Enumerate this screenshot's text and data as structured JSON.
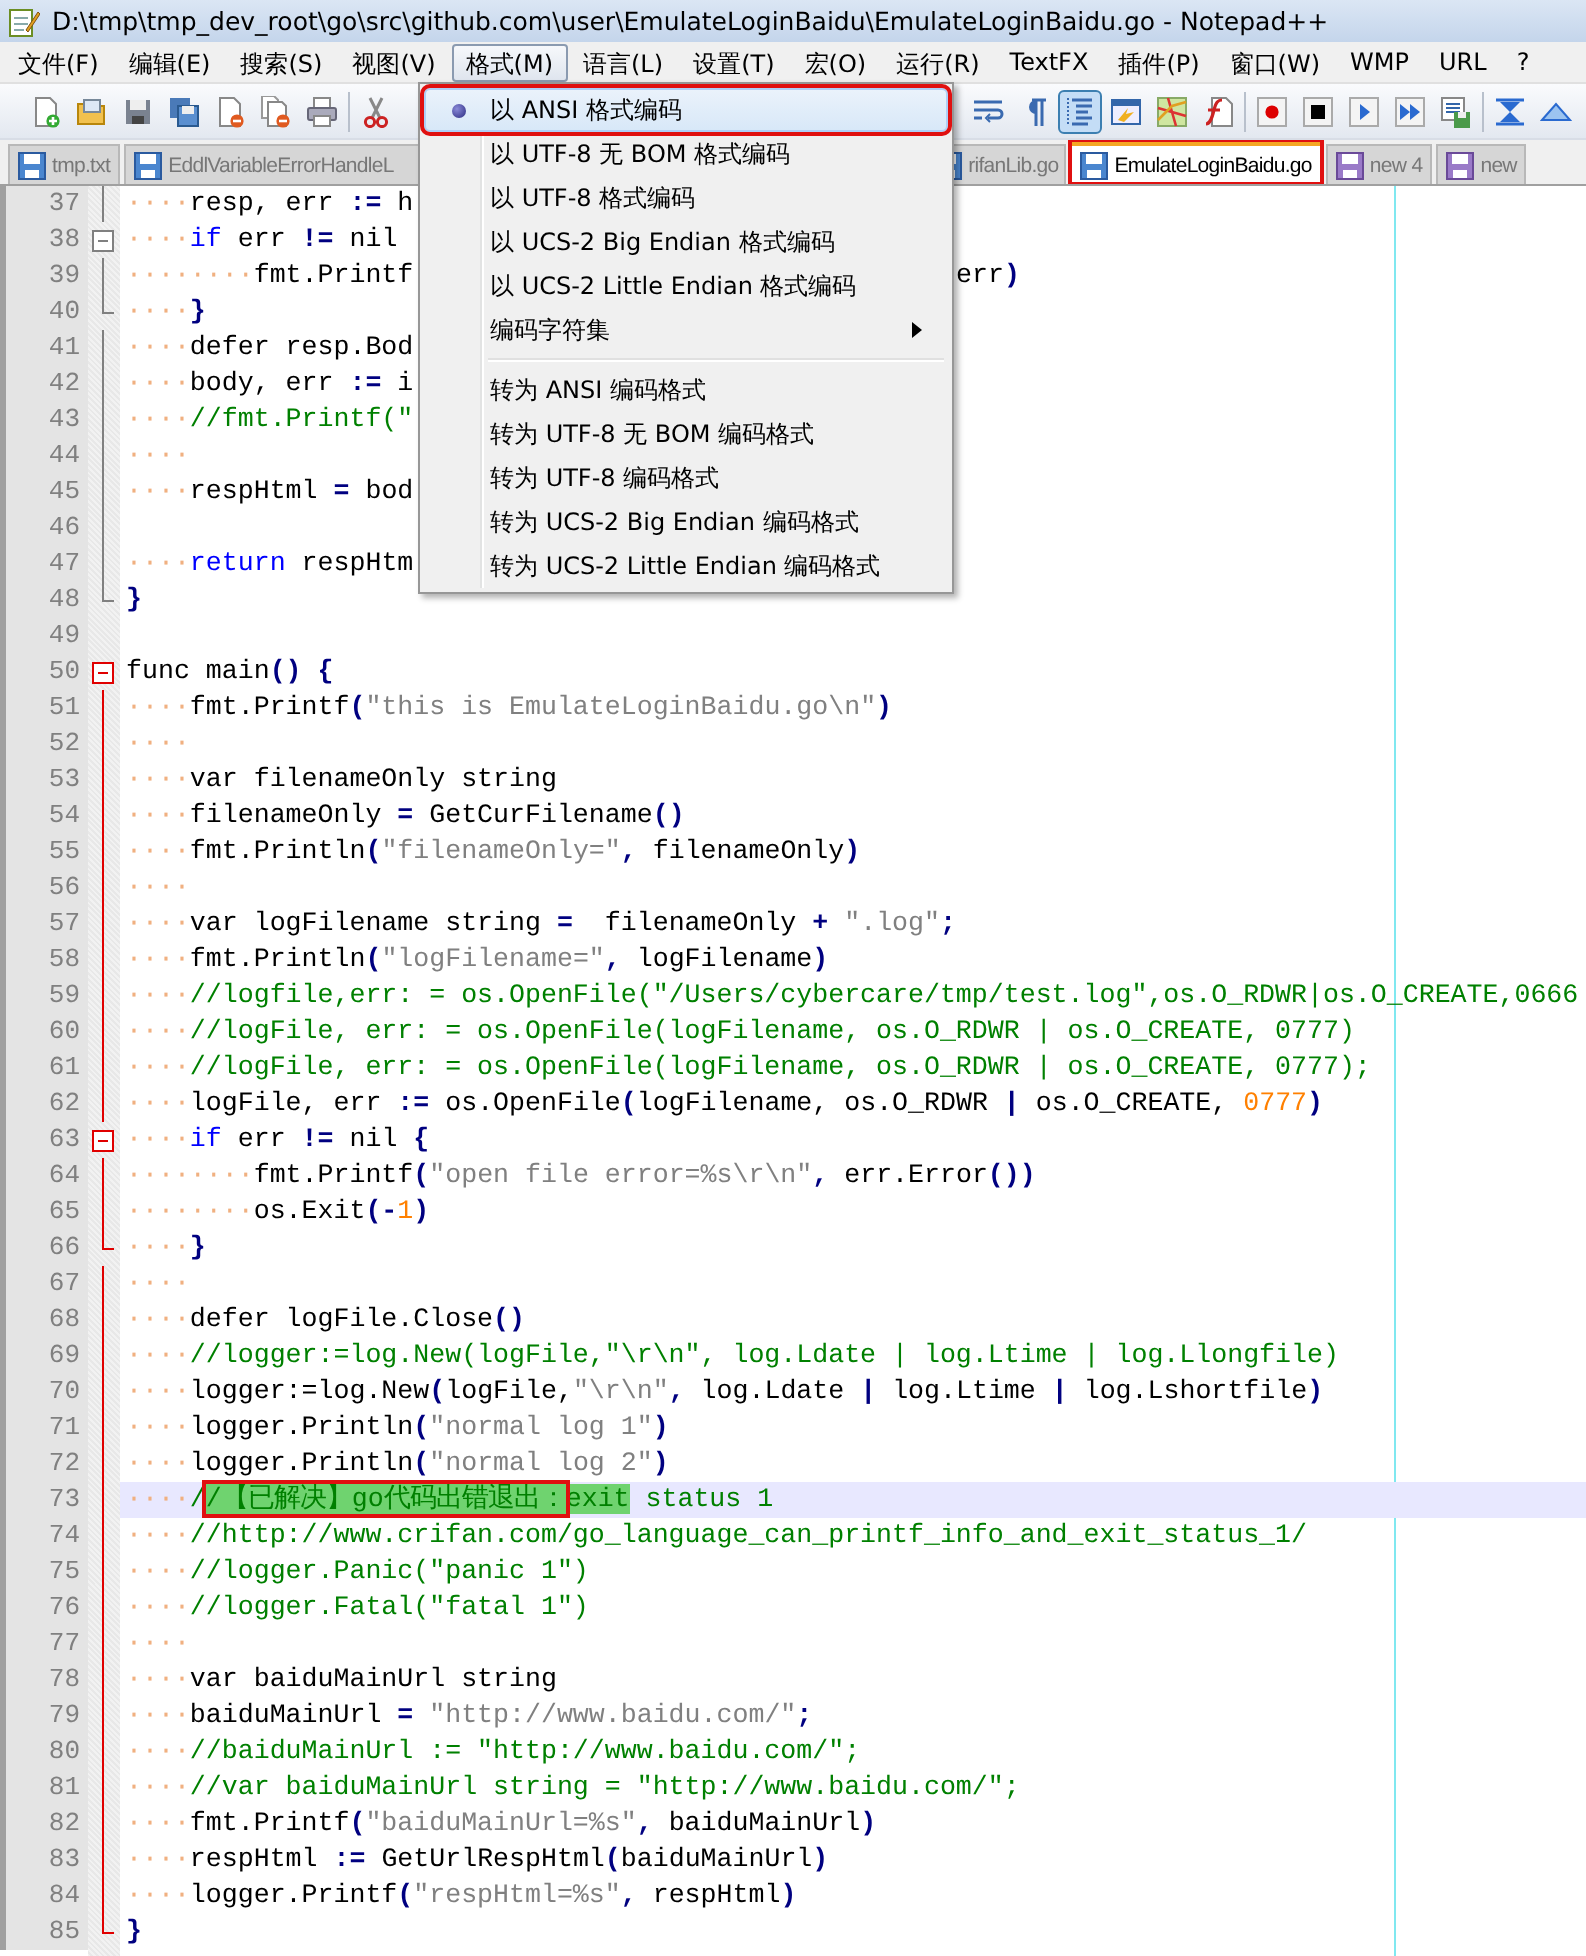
{
  "window": {
    "title": "D:\\tmp\\tmp_dev_root\\go\\src\\github.com\\user\\EmulateLoginBaidu\\EmulateLoginBaidu.go - Notepad++"
  },
  "menu_bar": [
    {
      "label": "文件(F)",
      "selected": false
    },
    {
      "label": "编辑(E)",
      "selected": false
    },
    {
      "label": "搜索(S)",
      "selected": false
    },
    {
      "label": "视图(V)",
      "selected": false
    },
    {
      "label": "格式(M)",
      "selected": true
    },
    {
      "label": "语言(L)",
      "selected": false
    },
    {
      "label": "设置(T)",
      "selected": false
    },
    {
      "label": "宏(O)",
      "selected": false
    },
    {
      "label": "运行(R)",
      "selected": false
    },
    {
      "label": "TextFX",
      "selected": false
    },
    {
      "label": "插件(P)",
      "selected": false
    },
    {
      "label": "窗口(W)",
      "selected": false
    },
    {
      "label": "WMP",
      "selected": false
    },
    {
      "label": "URL",
      "selected": false
    },
    {
      "label": "?",
      "selected": false
    }
  ],
  "toolbar_left": [
    {
      "kind": "page-plus",
      "pressed": false
    },
    {
      "kind": "folder",
      "pressed": false
    },
    {
      "kind": "floppy",
      "pressed": false
    },
    {
      "kind": "floppies",
      "pressed": false
    },
    {
      "kind": "page-minus",
      "pressed": false
    },
    {
      "kind": "pages-minus",
      "pressed": false
    },
    {
      "kind": "printer",
      "pressed": false
    },
    {
      "kind": "separator"
    },
    {
      "kind": "scissors",
      "pressed": false
    }
  ],
  "toolbar_right": [
    {
      "kind": "wrap-lines",
      "pressed": false
    },
    {
      "kind": "pilcrow",
      "pressed": false
    },
    {
      "kind": "indent-guide",
      "pressed": true
    },
    {
      "kind": "window-panel",
      "pressed": false
    },
    {
      "kind": "map",
      "pressed": false
    },
    {
      "kind": "function-doc",
      "pressed": false
    },
    {
      "kind": "separator"
    },
    {
      "kind": "record-dot",
      "pressed": false
    },
    {
      "kind": "stop-square",
      "pressed": false
    },
    {
      "kind": "play-triangle",
      "pressed": false
    },
    {
      "kind": "fast-forward",
      "pressed": false
    },
    {
      "kind": "floppy-list",
      "pressed": false
    },
    {
      "kind": "separator"
    },
    {
      "kind": "collapse-arrows",
      "pressed": false
    },
    {
      "kind": "up-triangle",
      "pressed": false
    }
  ],
  "tabs": [
    {
      "label": "tmp.txt",
      "selected": false,
      "unsaved": false,
      "annotated": false
    },
    {
      "label": "EddlVariableErrorHandleL",
      "selected": false,
      "unsaved": false,
      "annotated": false
    },
    {
      "label": "rifanLib.go",
      "selected": false,
      "annotated": false
    },
    {
      "label": "EmulateLoginBaidu.go",
      "selected": true,
      "unsaved": false,
      "annotated": true
    },
    {
      "label": "new  4",
      "selected": false,
      "unsaved": true,
      "annotated": false
    },
    {
      "label": "new",
      "selected": false,
      "unsaved": true,
      "annotated": false
    }
  ],
  "format_menu": [
    {
      "kind": "radio-item",
      "label": "以 ANSI 格式编码",
      "checked": true,
      "selected": true,
      "annotated": true
    },
    {
      "kind": "radio-item",
      "label": "以 UTF-8 无 BOM 格式编码",
      "checked": false,
      "selected": false,
      "annotated": false
    },
    {
      "kind": "radio-item",
      "label": "以 UTF-8 格式编码",
      "checked": false,
      "selected": false,
      "annotated": false
    },
    {
      "kind": "radio-item",
      "label": "以 UCS-2 Big Endian 格式编码",
      "checked": false,
      "selected": false,
      "annotated": false
    },
    {
      "kind": "radio-item",
      "label": "以 UCS-2 Little Endian 格式编码",
      "checked": false,
      "selected": false,
      "annotated": false
    },
    {
      "kind": "submenu",
      "label": "编码字符集",
      "checked": false,
      "selected": false,
      "annotated": false
    },
    {
      "kind": "separator"
    },
    {
      "kind": "radio-item",
      "label": "转为 ANSI 编码格式",
      "checked": false,
      "selected": false,
      "annotated": false
    },
    {
      "kind": "radio-item",
      "label": "转为 UTF-8 无 BOM 编码格式",
      "checked": false,
      "selected": false,
      "annotated": false
    },
    {
      "kind": "radio-item",
      "label": "转为 UTF-8 编码格式",
      "checked": false,
      "selected": false,
      "annotated": false
    },
    {
      "kind": "radio-item",
      "label": "转为 UCS-2 Big Endian 编码格式",
      "checked": false,
      "selected": false,
      "annotated": false
    },
    {
      "kind": "radio-item",
      "label": "转为 UCS-2 Little Endian 编码格式",
      "checked": false,
      "selected": false,
      "annotated": false
    }
  ],
  "lines": [
    {
      "number": "37",
      "fold": {
        "kind": "line",
        "active": false
      },
      "current": false,
      "tokens": [
        {
          "text": "····",
          "kind": "ws"
        },
        {
          "text": "resp, err ",
          "kind": "id"
        },
        {
          "text": ":=",
          "kind": "op"
        },
        {
          "text": " h",
          "kind": "id"
        }
      ]
    },
    {
      "number": "38",
      "fold": {
        "kind": "open",
        "active": false
      },
      "current": false,
      "tokens": [
        {
          "text": "····",
          "kind": "ws"
        },
        {
          "text": "if",
          "kind": "kw"
        },
        {
          "text": " err ",
          "kind": "id"
        },
        {
          "text": "!=",
          "kind": "op"
        },
        {
          "text": " nil",
          "kind": "id"
        }
      ]
    },
    {
      "number": "39",
      "fold": {
        "kind": "line",
        "active": false
      },
      "current": false,
      "tokens": [
        {
          "text": "········",
          "kind": "ws"
        },
        {
          "text": "fmt.Printf",
          "kind": "id"
        }
      ],
      "tail": [
        {
          "text": "err",
          "kind": "id"
        },
        {
          "text": ")",
          "kind": "op"
        }
      ]
    },
    {
      "number": "40",
      "fold": {
        "kind": "end",
        "active": false
      },
      "current": false,
      "tokens": [
        {
          "text": "····",
          "kind": "ws"
        },
        {
          "text": "}",
          "kind": "op"
        }
      ]
    },
    {
      "number": "41",
      "fold": {
        "kind": "line",
        "active": false
      },
      "current": false,
      "tokens": [
        {
          "text": "····",
          "kind": "ws"
        },
        {
          "text": "defer resp.Bod",
          "kind": "id"
        }
      ]
    },
    {
      "number": "42",
      "fold": {
        "kind": "line",
        "active": false
      },
      "current": false,
      "tokens": [
        {
          "text": "····",
          "kind": "ws"
        },
        {
          "text": "body, err ",
          "kind": "id"
        },
        {
          "text": ":=",
          "kind": "op"
        },
        {
          "text": " i",
          "kind": "id"
        }
      ]
    },
    {
      "number": "43",
      "fold": {
        "kind": "line",
        "active": false
      },
      "current": false,
      "tokens": [
        {
          "text": "····",
          "kind": "ws"
        },
        {
          "text": "//fmt.Printf(\"",
          "kind": "cmt"
        }
      ]
    },
    {
      "number": "44",
      "fold": {
        "kind": "line",
        "active": false
      },
      "current": false,
      "tokens": [
        {
          "text": "····",
          "kind": "ws"
        }
      ]
    },
    {
      "number": "45",
      "fold": {
        "kind": "line",
        "active": false
      },
      "current": false,
      "tokens": [
        {
          "text": "····",
          "kind": "ws"
        },
        {
          "text": "respHtml ",
          "kind": "id"
        },
        {
          "text": "=",
          "kind": "op"
        },
        {
          "text": " bod",
          "kind": "id"
        }
      ]
    },
    {
      "number": "46",
      "fold": {
        "kind": "line",
        "active": false
      },
      "current": false
    },
    {
      "number": "47",
      "fold": {
        "kind": "line",
        "active": false
      },
      "current": false,
      "tokens": [
        {
          "text": "····",
          "kind": "ws"
        },
        {
          "text": "return",
          "kind": "kw"
        },
        {
          "text": " respHtm",
          "kind": "id"
        }
      ]
    },
    {
      "number": "48",
      "fold": {
        "kind": "end",
        "active": false
      },
      "current": false,
      "tokens": [
        {
          "text": "}",
          "kind": "op"
        }
      ]
    },
    {
      "number": "49",
      "current": false
    },
    {
      "number": "50",
      "fold": {
        "kind": "open",
        "active": true
      },
      "current": false,
      "tokens": [
        {
          "text": "func main",
          "kind": "id"
        },
        {
          "text": "() {",
          "kind": "op"
        }
      ]
    },
    {
      "number": "51",
      "fold": {
        "kind": "line",
        "active": true
      },
      "current": false,
      "tokens": [
        {
          "text": "····",
          "kind": "ws"
        },
        {
          "text": "fmt.Printf",
          "kind": "id"
        },
        {
          "text": "(",
          "kind": "op"
        },
        {
          "text": "\"this is EmulateLoginBaidu.go\\n\"",
          "kind": "str"
        },
        {
          "text": ")",
          "kind": "op"
        }
      ]
    },
    {
      "number": "52",
      "fold": {
        "kind": "line",
        "active": true
      },
      "current": false,
      "tokens": [
        {
          "text": "····",
          "kind": "ws"
        }
      ]
    },
    {
      "number": "53",
      "fold": {
        "kind": "line",
        "active": true
      },
      "current": false,
      "tokens": [
        {
          "text": "····",
          "kind": "ws"
        },
        {
          "text": "var filenameOnly string",
          "kind": "id"
        }
      ]
    },
    {
      "number": "54",
      "fold": {
        "kind": "line",
        "active": true
      },
      "current": false,
      "tokens": [
        {
          "text": "····",
          "kind": "ws"
        },
        {
          "text": "filenameOnly ",
          "kind": "id"
        },
        {
          "text": "=",
          "kind": "op"
        },
        {
          "text": " GetCurFilename",
          "kind": "id"
        },
        {
          "text": "()",
          "kind": "op"
        }
      ]
    },
    {
      "number": "55",
      "fold": {
        "kind": "line",
        "active": true
      },
      "current": false,
      "tokens": [
        {
          "text": "····",
          "kind": "ws"
        },
        {
          "text": "fmt.Println",
          "kind": "id"
        },
        {
          "text": "(",
          "kind": "op"
        },
        {
          "text": "\"filenameOnly=\"",
          "kind": "str"
        },
        {
          "text": ",",
          "kind": "op"
        },
        {
          "text": " filenameOnly",
          "kind": "id"
        },
        {
          "text": ")",
          "kind": "op"
        }
      ]
    },
    {
      "number": "56",
      "fold": {
        "kind": "line",
        "active": true
      },
      "current": false,
      "tokens": [
        {
          "text": "····",
          "kind": "ws"
        }
      ]
    },
    {
      "number": "57",
      "fold": {
        "kind": "line",
        "active": true
      },
      "current": false,
      "tokens": [
        {
          "text": "····",
          "kind": "ws"
        },
        {
          "text": "var logFilename string ",
          "kind": "id"
        },
        {
          "text": "=",
          "kind": "op"
        },
        {
          "text": "  filenameOnly ",
          "kind": "id"
        },
        {
          "text": "+",
          "kind": "op"
        },
        {
          "text": " \".log\"",
          "kind": "str"
        },
        {
          "text": ";",
          "kind": "op"
        }
      ]
    },
    {
      "number": "58",
      "fold": {
        "kind": "line",
        "active": true
      },
      "current": false,
      "tokens": [
        {
          "text": "····",
          "kind": "ws"
        },
        {
          "text": "fmt.Println",
          "kind": "id"
        },
        {
          "text": "(",
          "kind": "op"
        },
        {
          "text": "\"logFilename=\"",
          "kind": "str"
        },
        {
          "text": ",",
          "kind": "op"
        },
        {
          "text": " logFilename",
          "kind": "id"
        },
        {
          "text": ")",
          "kind": "op"
        }
      ]
    },
    {
      "number": "59",
      "fold": {
        "kind": "line",
        "active": true
      },
      "current": false,
      "tokens": [
        {
          "text": "····",
          "kind": "ws"
        },
        {
          "text": "//logfile,err: = os.OpenFile(\"/Users/cybercare/tmp/test.log\",os.O_RDWR|os.O_CREATE,0666",
          "kind": "cmt"
        }
      ]
    },
    {
      "number": "60",
      "fold": {
        "kind": "line",
        "active": true
      },
      "current": false,
      "tokens": [
        {
          "text": "····",
          "kind": "ws"
        },
        {
          "text": "//logFile, err: = os.OpenFile(logFilename, os.O_RDWR | os.O_CREATE, 0777)",
          "kind": "cmt"
        }
      ]
    },
    {
      "number": "61",
      "fold": {
        "kind": "line",
        "active": true
      },
      "current": false,
      "tokens": [
        {
          "text": "····",
          "kind": "ws"
        },
        {
          "text": "//logFile, err: = os.OpenFile(logFilename, os.O_RDWR | os.O_CREATE, 0777);",
          "kind": "cmt"
        }
      ]
    },
    {
      "number": "62",
      "fold": {
        "kind": "line",
        "active": true
      },
      "current": false,
      "tokens": [
        {
          "text": "····",
          "kind": "ws"
        },
        {
          "text": "logFile, err ",
          "kind": "id"
        },
        {
          "text": ":=",
          "kind": "op"
        },
        {
          "text": " os.OpenFile",
          "kind": "id"
        },
        {
          "text": "(",
          "kind": "op"
        },
        {
          "text": "logFilename, os.O_RDWR ",
          "kind": "id"
        },
        {
          "text": "|",
          "kind": "op"
        },
        {
          "text": " os.O_CREATE, ",
          "kind": "id"
        },
        {
          "text": "0777",
          "kind": "num"
        },
        {
          "text": ")",
          "kind": "op"
        }
      ]
    },
    {
      "number": "63",
      "fold": {
        "kind": "open",
        "active": true
      },
      "current": false,
      "tokens": [
        {
          "text": "····",
          "kind": "ws"
        },
        {
          "text": "if",
          "kind": "kw"
        },
        {
          "text": " err ",
          "kind": "id"
        },
        {
          "text": "!=",
          "kind": "op"
        },
        {
          "text": " nil ",
          "kind": "id"
        },
        {
          "text": "{",
          "kind": "op"
        }
      ]
    },
    {
      "number": "64",
      "fold": {
        "kind": "line",
        "active": true
      },
      "current": false,
      "tokens": [
        {
          "text": "········",
          "kind": "ws"
        },
        {
          "text": "fmt.Printf",
          "kind": "id"
        },
        {
          "text": "(",
          "kind": "op"
        },
        {
          "text": "\"open file error=%s\\r\\n\"",
          "kind": "str"
        },
        {
          "text": ",",
          "kind": "op"
        },
        {
          "text": " err.Error",
          "kind": "id"
        },
        {
          "text": "())",
          "kind": "op"
        }
      ]
    },
    {
      "number": "65",
      "fold": {
        "kind": "line",
        "active": true
      },
      "current": false,
      "tokens": [
        {
          "text": "········",
          "kind": "ws"
        },
        {
          "text": "os.Exit",
          "kind": "id"
        },
        {
          "text": "(-",
          "kind": "op"
        },
        {
          "text": "1",
          "kind": "num"
        },
        {
          "text": ")",
          "kind": "op"
        }
      ]
    },
    {
      "number": "66",
      "fold": {
        "kind": "end",
        "active": true
      },
      "current": false,
      "tokens": [
        {
          "text": "····",
          "kind": "ws"
        },
        {
          "text": "}",
          "kind": "op"
        }
      ]
    },
    {
      "number": "67",
      "fold": {
        "kind": "line",
        "active": true
      },
      "current": false,
      "tokens": [
        {
          "text": "····",
          "kind": "ws"
        }
      ]
    },
    {
      "number": "68",
      "fold": {
        "kind": "line",
        "active": true
      },
      "current": false,
      "tokens": [
        {
          "text": "····",
          "kind": "ws"
        },
        {
          "text": "defer logFile.Close",
          "kind": "id"
        },
        {
          "text": "()",
          "kind": "op"
        }
      ]
    },
    {
      "number": "69",
      "fold": {
        "kind": "line",
        "active": true
      },
      "current": false,
      "tokens": [
        {
          "text": "····",
          "kind": "ws"
        },
        {
          "text": "//logger:=log.New(logFile,\"\\r\\n\", log.Ldate | log.Ltime | log.Llongfile)",
          "kind": "cmt"
        }
      ]
    },
    {
      "number": "70",
      "fold": {
        "kind": "line",
        "active": true
      },
      "current": false,
      "tokens": [
        {
          "text": "····",
          "kind": "ws"
        },
        {
          "text": "logger:=log.New",
          "kind": "id"
        },
        {
          "text": "(",
          "kind": "op"
        },
        {
          "text": "logFile,",
          "kind": "id"
        },
        {
          "text": "\"\\r\\n\"",
          "kind": "str"
        },
        {
          "text": ",",
          "kind": "op"
        },
        {
          "text": " log.Ldate ",
          "kind": "id"
        },
        {
          "text": "|",
          "kind": "op"
        },
        {
          "text": " log.Ltime ",
          "kind": "id"
        },
        {
          "text": "|",
          "kind": "op"
        },
        {
          "text": " log.Lshortfile",
          "kind": "id"
        },
        {
          "text": ")",
          "kind": "op"
        }
      ]
    },
    {
      "number": "71",
      "fold": {
        "kind": "line",
        "active": true
      },
      "current": false,
      "tokens": [
        {
          "text": "····",
          "kind": "ws"
        },
        {
          "text": "logger.Println",
          "kind": "id"
        },
        {
          "text": "(",
          "kind": "op"
        },
        {
          "text": "\"normal log 1\"",
          "kind": "str"
        },
        {
          "text": ")",
          "kind": "op"
        }
      ]
    },
    {
      "number": "72",
      "fold": {
        "kind": "line",
        "active": true
      },
      "current": false,
      "tokens": [
        {
          "text": "····",
          "kind": "ws"
        },
        {
          "text": "logger.Println",
          "kind": "id"
        },
        {
          "text": "(",
          "kind": "op"
        },
        {
          "text": "\"normal log 2\"",
          "kind": "str"
        },
        {
          "text": ")",
          "kind": "op"
        }
      ]
    },
    {
      "number": "73",
      "fold": {
        "kind": "line",
        "active": true
      },
      "current": true,
      "tokens": [
        {
          "text": "····",
          "kind": "ws"
        },
        {
          "text": "/",
          "kind": "cmt"
        },
        {
          "text": "/【已解决】go代码出错退出：",
          "kind": "mark-boxed"
        },
        {
          "text": "exit",
          "kind": "mark"
        },
        {
          "text": " status 1",
          "kind": "cmt"
        }
      ]
    },
    {
      "number": "74",
      "fold": {
        "kind": "line",
        "active": true
      },
      "current": false,
      "tokens": [
        {
          "text": "····",
          "kind": "ws"
        },
        {
          "text": "//http://www.crifan.com/go_language_can_printf_info_and_exit_status_1/",
          "kind": "cmt"
        }
      ]
    },
    {
      "number": "75",
      "fold": {
        "kind": "line",
        "active": true
      },
      "current": false,
      "tokens": [
        {
          "text": "····",
          "kind": "ws"
        },
        {
          "text": "//logger.Panic(\"panic 1\")",
          "kind": "cmt"
        }
      ]
    },
    {
      "number": "76",
      "fold": {
        "kind": "line",
        "active": true
      },
      "current": false,
      "tokens": [
        {
          "text": "····",
          "kind": "ws"
        },
        {
          "text": "//logger.Fatal(\"fatal 1\")",
          "kind": "cmt"
        }
      ]
    },
    {
      "number": "77",
      "fold": {
        "kind": "line",
        "active": true
      },
      "current": false,
      "tokens": [
        {
          "text": "····",
          "kind": "ws"
        }
      ]
    },
    {
      "number": "78",
      "fold": {
        "kind": "line",
        "active": true
      },
      "current": false,
      "tokens": [
        {
          "text": "····",
          "kind": "ws"
        },
        {
          "text": "var baiduMainUrl string",
          "kind": "id"
        }
      ]
    },
    {
      "number": "79",
      "fold": {
        "kind": "line",
        "active": true
      },
      "current": false,
      "tokens": [
        {
          "text": "····",
          "kind": "ws"
        },
        {
          "text": "baiduMainUrl ",
          "kind": "id"
        },
        {
          "text": "=",
          "kind": "op"
        },
        {
          "text": " \"http://www.baidu.com/\"",
          "kind": "str"
        },
        {
          "text": ";",
          "kind": "op"
        }
      ]
    },
    {
      "number": "80",
      "fold": {
        "kind": "line",
        "active": true
      },
      "current": false,
      "tokens": [
        {
          "text": "····",
          "kind": "ws"
        },
        {
          "text": "//baiduMainUrl := \"http://www.baidu.com/\";",
          "kind": "cmt"
        }
      ]
    },
    {
      "number": "81",
      "fold": {
        "kind": "line",
        "active": true
      },
      "current": false,
      "tokens": [
        {
          "text": "····",
          "kind": "ws"
        },
        {
          "text": "//var baiduMainUrl string = \"http://www.baidu.com/\";",
          "kind": "cmt"
        }
      ]
    },
    {
      "number": "82",
      "fold": {
        "kind": "line",
        "active": true
      },
      "current": false,
      "tokens": [
        {
          "text": "····",
          "kind": "ws"
        },
        {
          "text": "fmt.Printf",
          "kind": "id"
        },
        {
          "text": "(",
          "kind": "op"
        },
        {
          "text": "\"baiduMainUrl=%s\"",
          "kind": "str"
        },
        {
          "text": ",",
          "kind": "op"
        },
        {
          "text": " baiduMainUrl",
          "kind": "id"
        },
        {
          "text": ")",
          "kind": "op"
        }
      ]
    },
    {
      "number": "83",
      "fold": {
        "kind": "line",
        "active": true
      },
      "current": false,
      "tokens": [
        {
          "text": "····",
          "kind": "ws"
        },
        {
          "text": "respHtml ",
          "kind": "id"
        },
        {
          "text": ":=",
          "kind": "op"
        },
        {
          "text": " GetUrlRespHtml",
          "kind": "id"
        },
        {
          "text": "(",
          "kind": "op"
        },
        {
          "text": "baiduMainUrl",
          "kind": "id"
        },
        {
          "text": ")",
          "kind": "op"
        }
      ]
    },
    {
      "number": "84",
      "fold": {
        "kind": "line",
        "active": true
      },
      "current": false,
      "tokens": [
        {
          "text": "····",
          "kind": "ws"
        },
        {
          "text": "logger.Printf",
          "kind": "id"
        },
        {
          "text": "(",
          "kind": "op"
        },
        {
          "text": "\"respHtml=%s\"",
          "kind": "str"
        },
        {
          "text": ",",
          "kind": "op"
        },
        {
          "text": " respHtml",
          "kind": "id"
        },
        {
          "text": ")",
          "kind": "op"
        }
      ]
    },
    {
      "number": "85",
      "fold": {
        "kind": "end",
        "active": true
      },
      "current": false,
      "tokens": [
        {
          "text": "}",
          "kind": "op"
        }
      ]
    }
  ]
}
